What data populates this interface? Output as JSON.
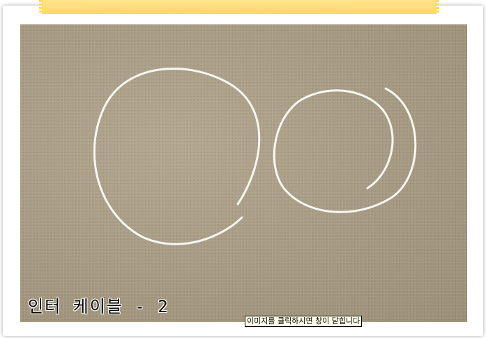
{
  "photo": {
    "caption": "인터 케이블 - 2",
    "close_hint": "이미지를 클릭하시면 창이 닫힙니다"
  },
  "colors": {
    "tape": "#ffd65e",
    "carpet": "#a79c84",
    "cable": "#ffffff"
  }
}
